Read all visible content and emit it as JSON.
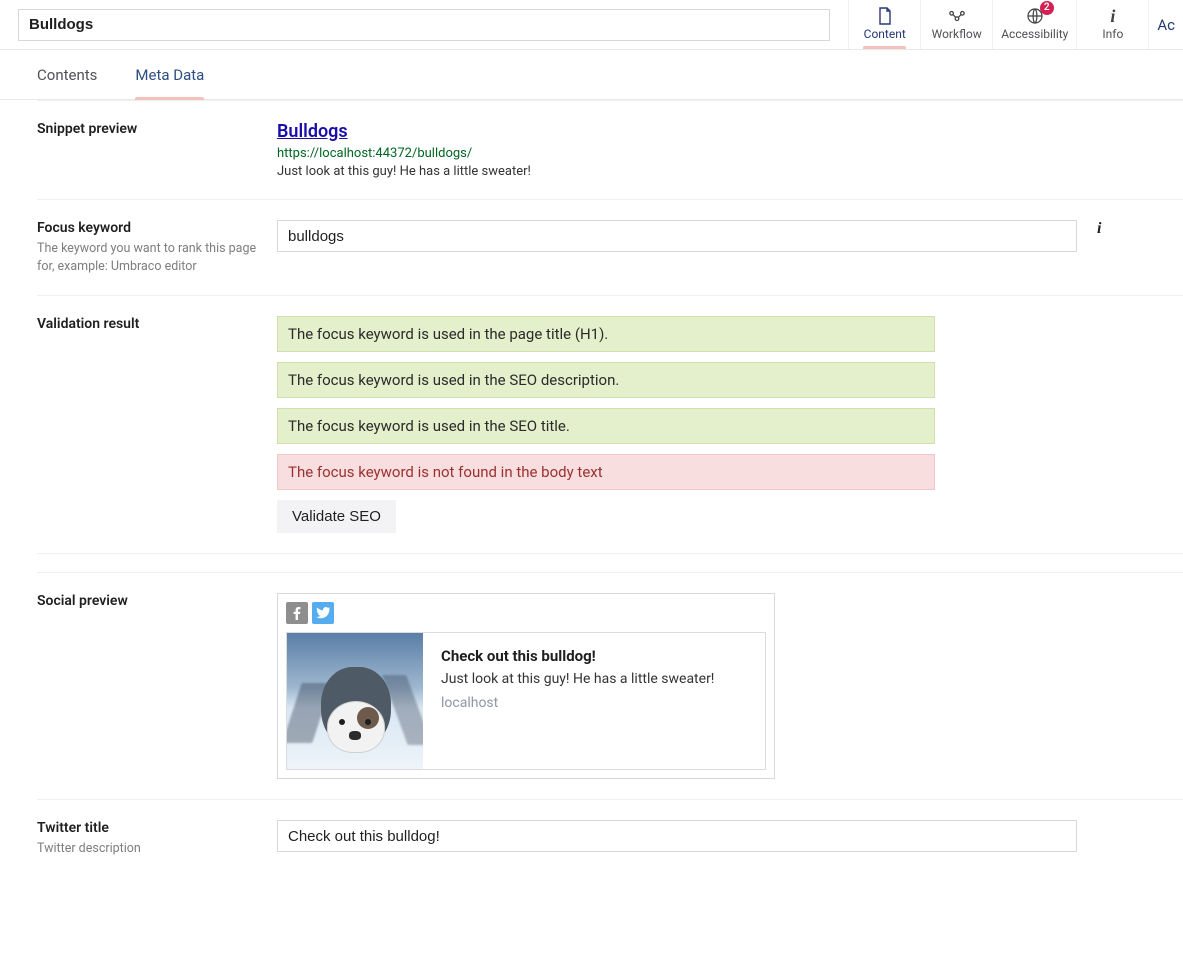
{
  "header": {
    "title_value": "Bulldogs",
    "apps": [
      {
        "key": "content",
        "label": "Content",
        "badge": null,
        "active": true
      },
      {
        "key": "workflow",
        "label": "Workflow",
        "badge": null,
        "active": false
      },
      {
        "key": "accessibility",
        "label": "Accessibility",
        "badge": "2",
        "active": false
      },
      {
        "key": "info",
        "label": "Info",
        "badge": null,
        "active": false
      }
    ],
    "cutoff": "Ac"
  },
  "subtabs": [
    {
      "key": "contents",
      "label": "Contents",
      "active": false
    },
    {
      "key": "metadata",
      "label": "Meta Data",
      "active": true
    }
  ],
  "snippet": {
    "section_label": "Snippet preview",
    "title": "Bulldogs",
    "url": "https://localhost:44372/bulldogs/",
    "desc": "Just look at this guy! He has a little sweater!"
  },
  "focus": {
    "section_label": "Focus keyword",
    "section_desc": "The keyword you want to rank this page for, example: Umbraco editor",
    "value": "bulldogs",
    "info_char": "i"
  },
  "validation": {
    "section_label": "Validation result",
    "items": [
      {
        "text": "The focus keyword is used in the page title (H1).",
        "ok": true
      },
      {
        "text": "The focus keyword is used in the SEO description.",
        "ok": true
      },
      {
        "text": "The focus keyword is used in the SEO title.",
        "ok": true
      },
      {
        "text": "The focus keyword is not found in the body text",
        "ok": false
      }
    ],
    "button": "Validate SEO"
  },
  "social": {
    "section_label": "Social preview",
    "card": {
      "title": "Check out this bulldog!",
      "desc": "Just look at this guy! He has a little sweater!",
      "host": "localhost"
    }
  },
  "twitter": {
    "title_label": "Twitter title",
    "desc_label": "Twitter description",
    "value": "Check out this bulldog!"
  }
}
